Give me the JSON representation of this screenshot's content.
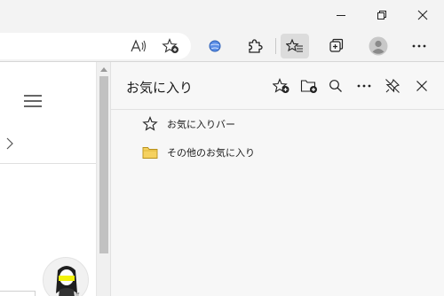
{
  "window": {
    "controls": [
      "minimize-icon",
      "restore-icon",
      "close-icon"
    ]
  },
  "toolbar": {
    "read_aloud_icon": "read-aloud-icon",
    "add_favorite_icon": "add-favorite-icon",
    "extension_icon": "globe-extension-icon",
    "extensions_icon": "puzzle-icon",
    "favorites_icon": "favorites-list-icon",
    "collections_icon": "collections-icon",
    "profile_icon": "profile-icon",
    "more_icon": "more-icon"
  },
  "favorites": {
    "title": "お気に入り",
    "actions": [
      "add-favorite-icon",
      "add-folder-icon",
      "search-icon",
      "more-icon",
      "unpin-icon",
      "close-icon"
    ],
    "items": [
      {
        "label": "お気に入りバー",
        "icon": "star-outline-icon"
      },
      {
        "label": "その他のお気に入り",
        "icon": "folder-icon"
      }
    ]
  },
  "colors": {
    "chrome": "#f3f3f3",
    "pane": "#f7f7f7",
    "folder": "#f5d15f",
    "avatar_highlight": "#f2f20a"
  }
}
